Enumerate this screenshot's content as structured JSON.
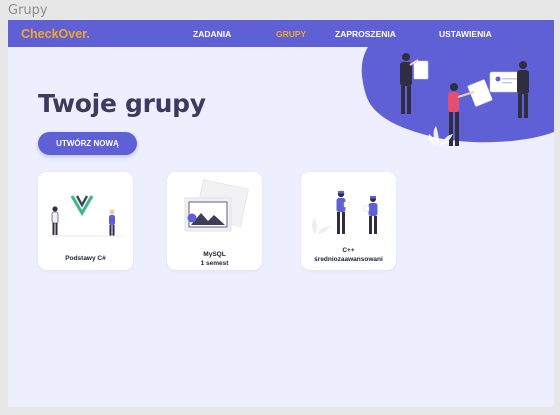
{
  "window": {
    "title": "Grupy"
  },
  "nav": {
    "logo": "CheckOver.",
    "items": [
      {
        "label": "ZADANIA",
        "active": false
      },
      {
        "label": "GRUPY",
        "active": true
      },
      {
        "label": "ZAPROSZENIA",
        "active": false
      },
      {
        "label": "USTAWIENIA",
        "active": false
      }
    ]
  },
  "main": {
    "title": "Twoje grupy",
    "create_button": "UTWÓRZ NOWĄ"
  },
  "groups": [
    {
      "name_line1": "Podstawy C#",
      "name_line2": "",
      "illustration": "vue-logo-people-illustration"
    },
    {
      "name_line1": "MySQL",
      "name_line2": "1 semest",
      "illustration": "image-placeholder-icon"
    },
    {
      "name_line1": "C++",
      "name_line2": "średniozaawansowani",
      "illustration": "team-people-illustration"
    }
  ],
  "colors": {
    "primary": "#5f5fd6",
    "accent": "#f5a623",
    "background": "#eeeffe",
    "title": "#3b3b5c"
  }
}
